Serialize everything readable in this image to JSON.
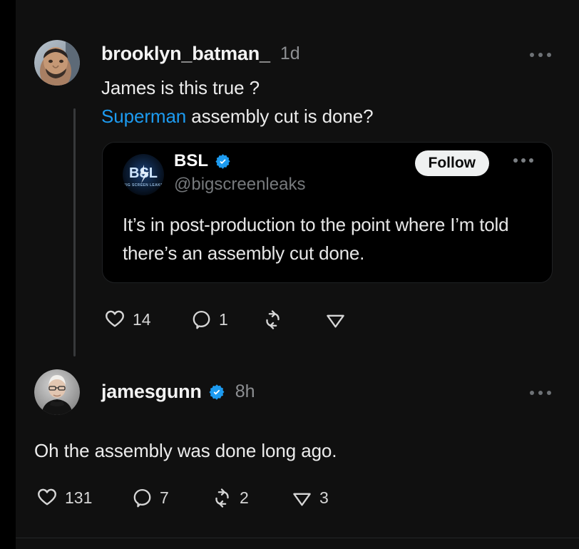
{
  "app": {
    "name": "threads-post-thread",
    "theme": "dark",
    "accent": "#1d9bf0"
  },
  "colors": {
    "page_background": "#000000",
    "feed_background": "#101010",
    "quote_card_background": "#000000",
    "link": "#1d9bf0",
    "verified_badge": "#1d9bf0",
    "follow_button_background": "#eff1f1",
    "primary_text": "#ececec",
    "secondary_text": "#8d8f92",
    "thread_line": "#37393b",
    "divider": "#242628"
  },
  "posts": [
    {
      "id": "post-1",
      "username": "brooklyn_batman_",
      "verified": false,
      "timestamp": "1d",
      "avatar_name": "avatar-brooklyn-batman",
      "more_menu_label": "More options",
      "text_lines": [
        {
          "segments": [
            {
              "text": "James is this true ?",
              "type": "plain"
            }
          ]
        },
        {
          "segments": [
            {
              "text": "Superman",
              "type": "link"
            },
            {
              "text": " assembly cut is done?",
              "type": "plain"
            }
          ]
        }
      ],
      "quote": {
        "name": "BSL",
        "verified": true,
        "handle": "@bigscreenleaks",
        "avatar_name": "avatar-bigscreenleaks",
        "follow_label": "Follow",
        "more_menu_label": "More options",
        "text": "It’s in post-production to the point where I’m told there’s an assembly cut done."
      },
      "actions": [
        {
          "icon": "heart-icon",
          "label": "Like",
          "count": "14"
        },
        {
          "icon": "comment-icon",
          "label": "Reply",
          "count": "1"
        },
        {
          "icon": "repost-icon",
          "label": "Repost",
          "count": ""
        },
        {
          "icon": "share-icon",
          "label": "Share",
          "count": ""
        }
      ]
    },
    {
      "id": "post-2",
      "username": "jamesgunn",
      "verified": true,
      "timestamp": "8h",
      "avatar_name": "avatar-jamesgunn",
      "more_menu_label": "More options",
      "text_lines": [
        {
          "segments": [
            {
              "text": "Oh the assembly was done long ago.",
              "type": "plain"
            }
          ]
        }
      ],
      "actions": [
        {
          "icon": "heart-icon",
          "label": "Like",
          "count": "131"
        },
        {
          "icon": "comment-icon",
          "label": "Reply",
          "count": "7"
        },
        {
          "icon": "repost-icon",
          "label": "Repost",
          "count": "2"
        },
        {
          "icon": "share-icon",
          "label": "Share",
          "count": "3"
        }
      ]
    }
  ]
}
